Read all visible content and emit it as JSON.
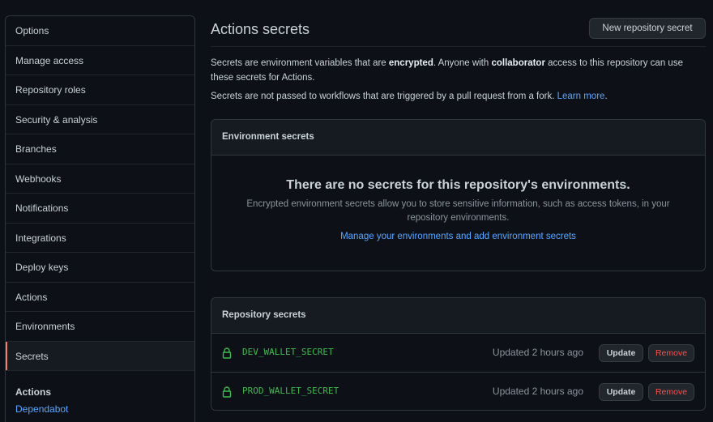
{
  "sidebar": {
    "items": [
      {
        "label": "Options"
      },
      {
        "label": "Manage access"
      },
      {
        "label": "Repository roles"
      },
      {
        "label": "Security & analysis"
      },
      {
        "label": "Branches"
      },
      {
        "label": "Webhooks"
      },
      {
        "label": "Notifications"
      },
      {
        "label": "Integrations"
      },
      {
        "label": "Deploy keys"
      },
      {
        "label": "Actions"
      },
      {
        "label": "Environments"
      },
      {
        "label": "Secrets"
      }
    ],
    "selected_index": 11,
    "group": {
      "title": "Actions",
      "links": [
        {
          "label": "Dependabot"
        }
      ]
    }
  },
  "header": {
    "title": "Actions secrets",
    "new_button": "New repository secret"
  },
  "description": {
    "p1_a": "Secrets are environment variables that are ",
    "p1_b": "encrypted",
    "p1_c": ". Anyone with ",
    "p1_d": "collaborator",
    "p1_e": " access to this repository can use these secrets for Actions.",
    "p2_a": "Secrets are not passed to workflows that are triggered by a pull request from a fork. ",
    "p2_link": "Learn more",
    "p2_b": "."
  },
  "environment_secrets": {
    "title": "Environment secrets",
    "blank_title": "There are no secrets for this repository's environments.",
    "blank_text": "Encrypted environment secrets allow you to store sensitive information, such as access tokens, in your repository environments.",
    "blank_link": "Manage your environments and add environment secrets"
  },
  "repository_secrets": {
    "title": "Repository secrets",
    "rows": [
      {
        "name": "DEV_WALLET_SECRET",
        "updated": "Updated 2 hours ago",
        "update_label": "Update",
        "remove_label": "Remove",
        "icon": "lock-icon"
      },
      {
        "name": "PROD_WALLET_SECRET",
        "updated": "Updated 2 hours ago",
        "update_label": "Update",
        "remove_label": "Remove",
        "icon": "lock-icon"
      }
    ]
  },
  "colors": {
    "background": "#0d1117",
    "accent_link": "#58a6ff",
    "secret_green": "#3fb950",
    "danger": "#f85149",
    "selected_marker": "#f78166"
  }
}
